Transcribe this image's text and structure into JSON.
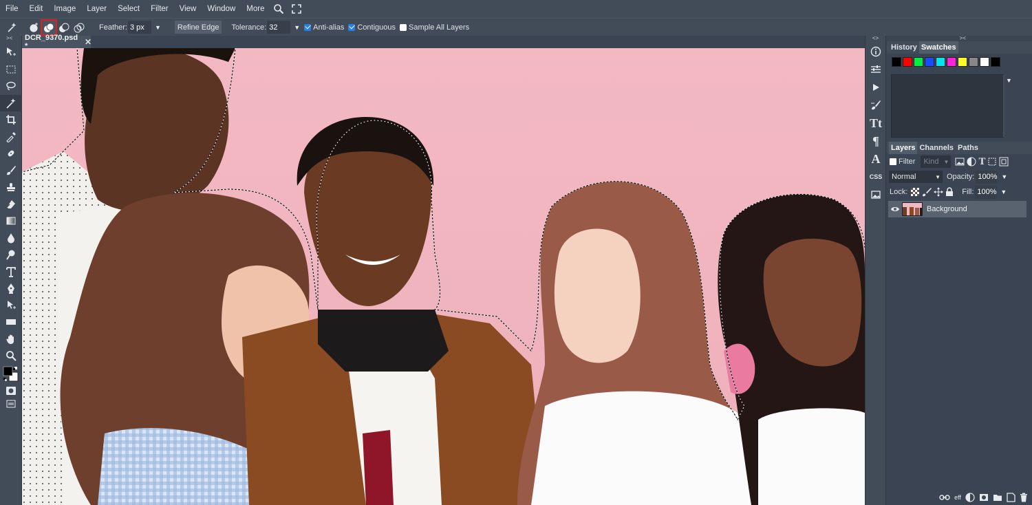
{
  "menu": [
    "File",
    "Edit",
    "Image",
    "Layer",
    "Select",
    "Filter",
    "View",
    "Window",
    "More"
  ],
  "options": {
    "feather_label": "Feather:",
    "feather_value": "3 px",
    "refine_edge": "Refine Edge",
    "tolerance_label": "Tolerance:",
    "tolerance_value": "32",
    "anti_alias": "Anti-alias",
    "contiguous": "Contiguous",
    "sample_all_layers": "Sample All Layers"
  },
  "document": {
    "tab_title": "DCR_9370.psd *",
    "close": "✕"
  },
  "panels": {
    "top_tabs": [
      "History",
      "Swatches"
    ],
    "swatch_colors": [
      "#000000",
      "#ff0000",
      "#00ee44",
      "#1a4cff",
      "#00e6f0",
      "#ff22dd",
      "#ffff22",
      "#888888",
      "#ffffff",
      "#000000"
    ],
    "layer_tabs": [
      "Layers",
      "Channels",
      "Paths"
    ],
    "filter_label": "Filter",
    "kind_placeholder": "Kind",
    "blend_mode": "Normal",
    "opacity_label": "Opacity:",
    "opacity_value": "100%",
    "lock_label": "Lock:",
    "fill_label": "Fill:",
    "fill_value": "100%",
    "layer_name": "Background"
  },
  "right_strip": {
    "css_label": "CSS"
  },
  "footer": {
    "eff": "eff"
  },
  "colors": {
    "bg": "#3a4452",
    "panel": "#424c58",
    "canvas_pink": "#f4b8c2",
    "highlight": "#e02020"
  }
}
